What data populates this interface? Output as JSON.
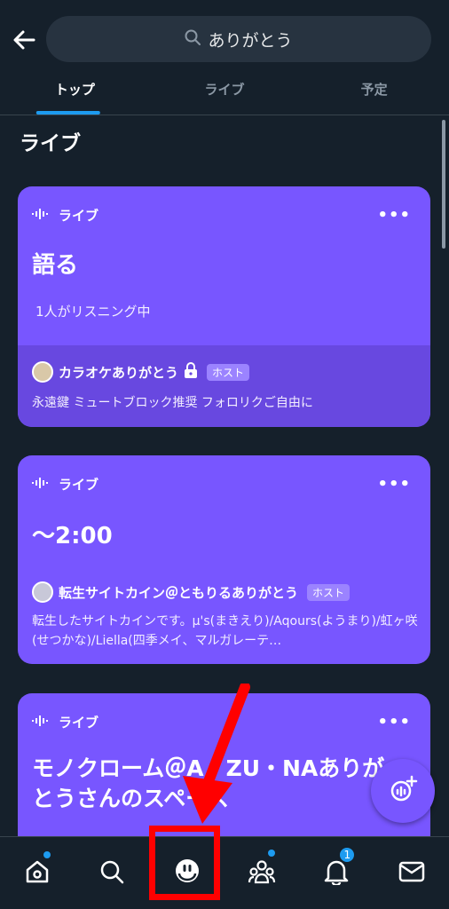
{
  "search": {
    "query": "ありがとう"
  },
  "tabs": [
    {
      "label": "トップ",
      "active": true
    },
    {
      "label": "ライブ",
      "active": false
    },
    {
      "label": "予定",
      "active": false
    }
  ],
  "section_title": "ライブ",
  "cards": [
    {
      "live_label": "ライブ",
      "title": "語る",
      "listeners": "1人がリスニング中",
      "host_name": "カラオケありがとう",
      "host_badge": "ホスト",
      "description": "永遠鍵 ミュートブロック推奨 フォロリクご自由に"
    },
    {
      "live_label": "ライブ",
      "title": "〜2:00",
      "host_name": "転生サイトカイン＠ともりるありがとう",
      "host_badge": "ホスト",
      "description": "転生したサイトカインです。μ's(まきえり)/Aqours(ようまり)/虹ヶ咲(せつかな)/Liella(四季メイ、マルガレーテ…"
    },
    {
      "live_label": "ライブ",
      "title_line1": "モノクローム＠A・ZU・NAありが",
      "title_line2": "とうさんのスペース"
    }
  ],
  "bottom_nav": {
    "items": [
      "home-icon",
      "search-icon",
      "spaces-icon",
      "communities-icon",
      "notifications-icon",
      "messages-icon"
    ],
    "notification_count": "1"
  },
  "colors": {
    "background": "#15202b",
    "card": "#7856ff",
    "accent": "#1d9bf0",
    "annotation": "#ff0000"
  }
}
